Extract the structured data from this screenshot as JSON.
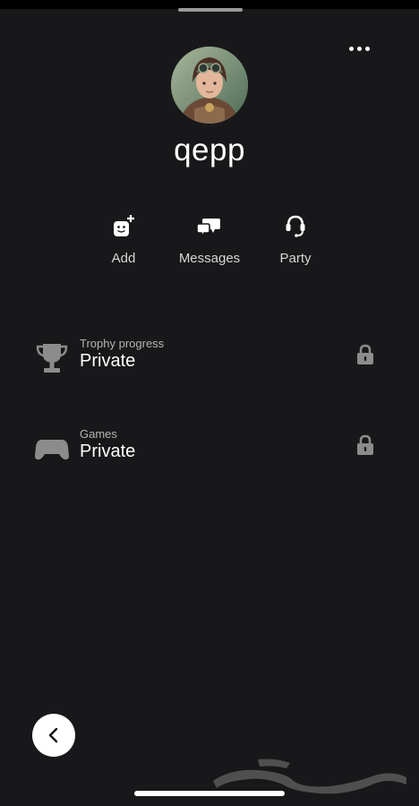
{
  "profile": {
    "username": "qepp"
  },
  "actions": [
    {
      "label": "Add",
      "icon": "add-friend-icon"
    },
    {
      "label": "Messages",
      "icon": "messages-icon"
    },
    {
      "label": "Party",
      "icon": "headset-icon"
    }
  ],
  "privacy_rows": [
    {
      "title": "Trophy progress",
      "value": "Private",
      "icon": "trophy-icon"
    },
    {
      "title": "Games",
      "value": "Private",
      "icon": "gamepad-icon"
    }
  ],
  "watermark": {
    "text": "حراج"
  },
  "colors": {
    "background": "#18181a",
    "icon_gray": "#8c8c8c"
  }
}
